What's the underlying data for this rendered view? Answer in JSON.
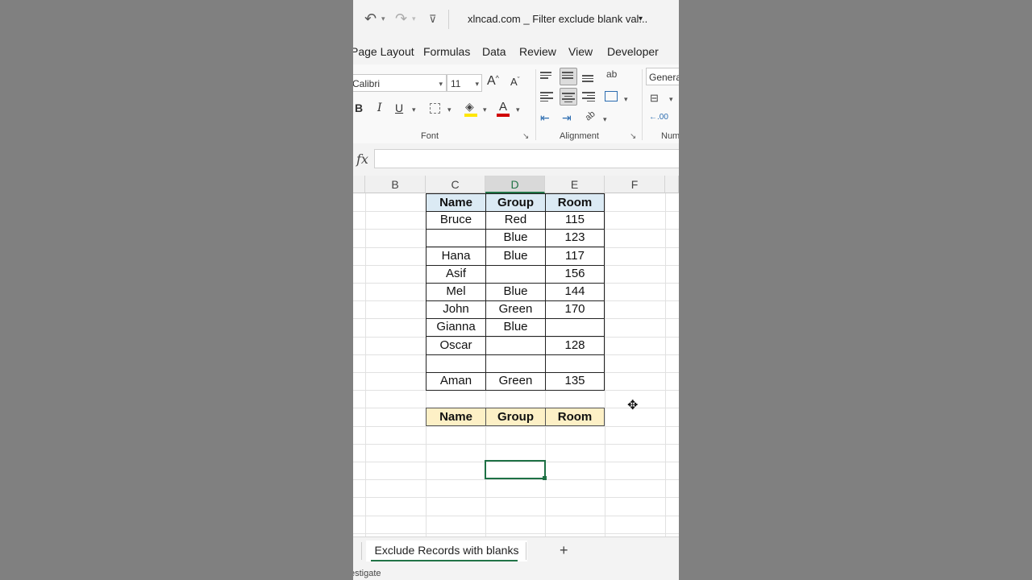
{
  "titlebar": {
    "title": "xlncad.com _ Filter exclude blank val...",
    "undo_icon": "↶",
    "redo_icon": "↷",
    "customize_icon": "⊽",
    "title_caret": "▾"
  },
  "menu": {
    "items": [
      "Page Layout",
      "Formulas",
      "Data",
      "Review",
      "View",
      "Developer"
    ]
  },
  "ribbon": {
    "font": {
      "name": "Calibri",
      "size": "11",
      "grow": "A",
      "shrink": "A",
      "bold": "B",
      "italic": "I",
      "underline": "U",
      "font_color_letter": "A",
      "group_label": "Font"
    },
    "alignment": {
      "group_label": "Alignment",
      "wrap_icon": "ab",
      "orientation_icon": "ab"
    },
    "number": {
      "format": "General",
      "group_label": "Num"
    },
    "launcher": "↘"
  },
  "formula_bar": {
    "fx": "fx",
    "value": ""
  },
  "grid": {
    "columns": [
      "B",
      "C",
      "D",
      "E",
      "F"
    ],
    "active_column": "D",
    "headers": [
      "Name",
      "Group",
      "Room"
    ],
    "rows": [
      [
        "Bruce",
        "Red",
        "115"
      ],
      [
        "",
        "Blue",
        "123"
      ],
      [
        "Hana",
        "Blue",
        "117"
      ],
      [
        "Asif",
        "",
        "156"
      ],
      [
        "Mel",
        "Blue",
        "144"
      ],
      [
        "John",
        "Green",
        "170"
      ],
      [
        "Gianna",
        "Blue",
        ""
      ],
      [
        "Oscar",
        "",
        "128"
      ],
      [
        "",
        "",
        ""
      ],
      [
        "Aman",
        "Green",
        "135"
      ]
    ],
    "output_headers": [
      "Name",
      "Group",
      "Room"
    ]
  },
  "sheet_tabs": {
    "active": "Exclude Records with blanks",
    "add": "+"
  },
  "status": {
    "text": "estigate"
  },
  "colors": {
    "excel_green": "#217346",
    "header_blue": "#dbeaf4",
    "header_yellow": "#fdf0c6",
    "highlight_yellow": "#ffe600",
    "font_red": "#d00000"
  }
}
